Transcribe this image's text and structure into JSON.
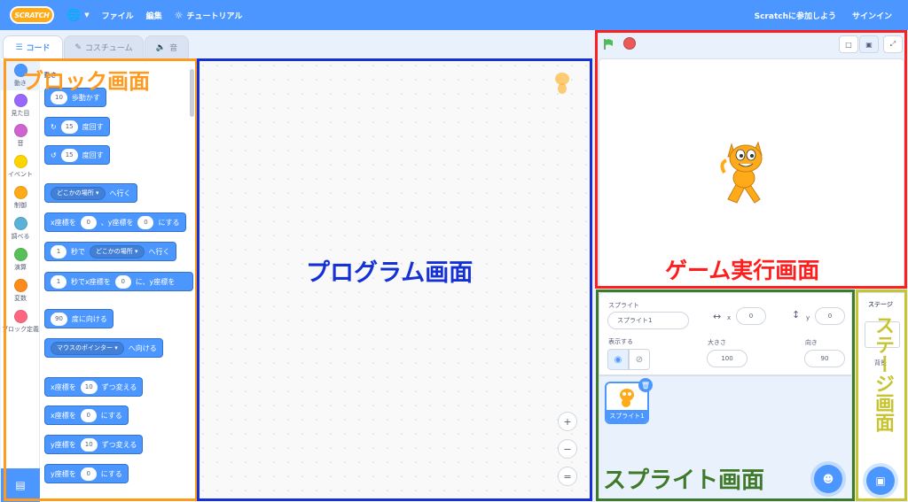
{
  "menubar": {
    "logo_text": "SCRATCH",
    "file": "ファイル",
    "edit": "編集",
    "tutorial": "チュートリアル",
    "join": "Scratchに参加しよう",
    "signin": "サインイン"
  },
  "tabs": {
    "code": "コード",
    "costume": "コスチューム",
    "sound": "音"
  },
  "categories": [
    {
      "label": "動き",
      "color": "#4c97ff"
    },
    {
      "label": "見た目",
      "color": "#9966ff"
    },
    {
      "label": "音",
      "color": "#cf63cf"
    },
    {
      "label": "イベント",
      "color": "#ffd500"
    },
    {
      "label": "制御",
      "color": "#ffab19"
    },
    {
      "label": "調べる",
      "color": "#5cb1d6"
    },
    {
      "label": "演算",
      "color": "#59c059"
    },
    {
      "label": "変数",
      "color": "#ff8c1a"
    },
    {
      "label": "ブロック定義",
      "color": "#ff6680"
    }
  ],
  "palette_heading": "動き",
  "blocks": {
    "move_val": "10",
    "move_txt": "歩動かす",
    "turn_r_val": "15",
    "turn_r_txt": "度回す",
    "turn_l_val": "15",
    "turn_l_txt": "度回す",
    "goto_dd": "どこかの場所",
    "goto_txt": "へ行く",
    "gotoxy_x_txt": "x座標を",
    "gotoxy_x_val": "0",
    "gotoxy_y_txt": "、y座標を",
    "gotoxy_y_val": "0",
    "gotoxy_end": "にする",
    "glide_val": "1",
    "glide_txt": "秒で",
    "glide_dd": "どこかの場所",
    "glide_end": "へ行く",
    "glidexy_val": "1",
    "glidexy_txt": "秒でx座標を",
    "glidexy_x": "0",
    "glidexy_mid": "に、y座標を",
    "point_val": "90",
    "point_txt": "度に向ける",
    "towards_dd": "マウスのポインター",
    "towards_txt": "へ向ける",
    "changex_txt": "x座標を",
    "changex_val": "10",
    "changex_end": "ずつ変える",
    "setx_txt": "x座標を",
    "setx_val": "0",
    "setx_end": "にする",
    "changey_txt": "y座標を",
    "changey_val": "10",
    "changey_end": "ずつ変える",
    "sety_txt": "y座標を",
    "sety_val": "0",
    "sety_end": "にする"
  },
  "zoom": {
    "in": "+",
    "out": "−",
    "reset": "="
  },
  "sprite": {
    "label": "スプライト",
    "name": "スプライト1",
    "x_label": "x",
    "x_val": "0",
    "y_label": "y",
    "y_val": "0",
    "show_label": "表示する",
    "size_label": "大きさ",
    "size_val": "100",
    "dir_label": "向き",
    "dir_val": "90",
    "thumb_name": "スプライト1"
  },
  "stage_panel": {
    "label": "ステージ",
    "bg_label": "背景"
  },
  "annotations": {
    "blocks": "ブロック画面",
    "program": "プログラム画面",
    "game": "ゲーム実行画面",
    "sprite": "スプライト画面",
    "stage": "ステージ画面"
  },
  "colors": {
    "orange": "#ff9a1e",
    "blue": "#1531d6",
    "red": "#ff1e1e",
    "green": "#3f7a2a",
    "yellow": "#c7c430"
  }
}
